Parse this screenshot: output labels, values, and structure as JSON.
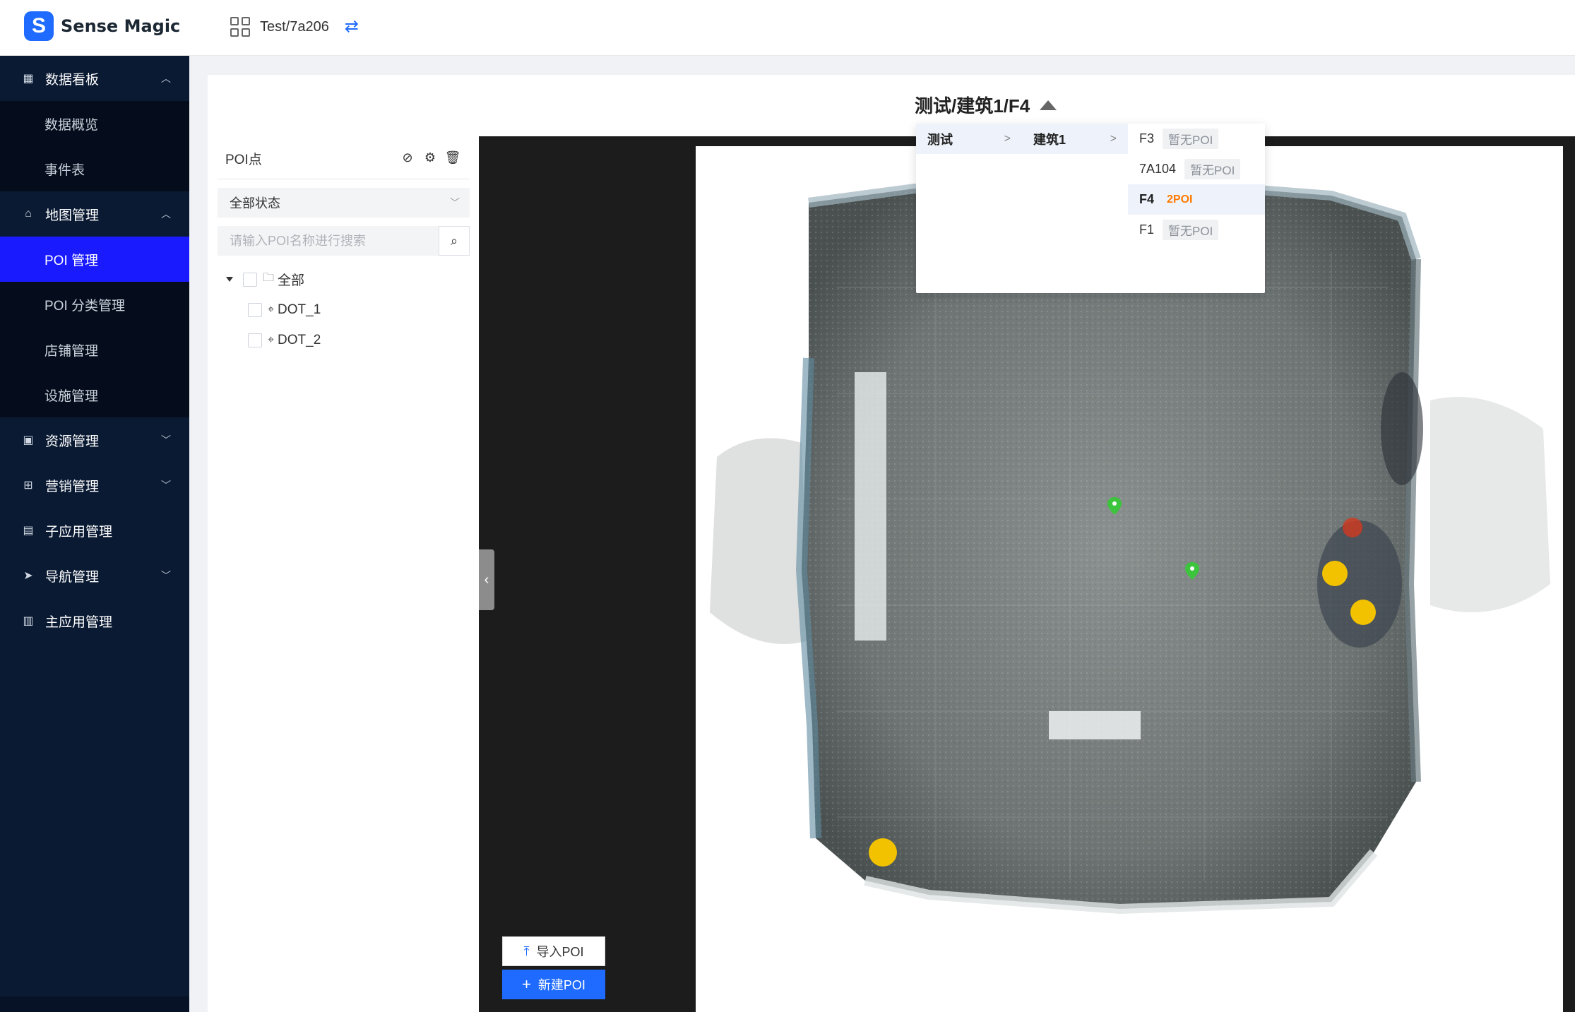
{
  "header": {
    "logo_letter": "S",
    "logo_text": "Sense Magic",
    "project_name": "Test/7a206"
  },
  "sidebar": {
    "groups": [
      {
        "label": "数据看板",
        "icon": "dashboard-icon",
        "expanded": true,
        "items": [
          "数据概览",
          "事件表"
        ]
      },
      {
        "label": "地图管理",
        "icon": "map-icon",
        "expanded": true,
        "items": [
          "POI 管理",
          "POI 分类管理",
          "店铺管理",
          "设施管理"
        ],
        "active_item": "POI 管理"
      },
      {
        "label": "资源管理",
        "icon": "resource-icon",
        "expanded": false
      },
      {
        "label": "营销管理",
        "icon": "marketing-icon",
        "expanded": false
      },
      {
        "label": "子应用管理",
        "icon": "subapp-icon",
        "expanded": false,
        "has_children": false
      },
      {
        "label": "导航管理",
        "icon": "navigation-icon",
        "expanded": false
      },
      {
        "label": "主应用管理",
        "icon": "mainapp-icon",
        "expanded": false,
        "has_children": false
      }
    ]
  },
  "floor_selector": {
    "title": "测试/建筑1/F4",
    "col1": [
      {
        "label": "测试",
        "selected": true
      }
    ],
    "col2": [
      {
        "label": "建筑1",
        "selected": true
      }
    ],
    "col3": [
      {
        "label": "F3",
        "tag": "暂无POI"
      },
      {
        "label": "7A104",
        "tag": "暂无POI"
      },
      {
        "label": "F4",
        "tag": "2POI",
        "selected": true
      },
      {
        "label": "F1",
        "tag": "暂无POI"
      }
    ]
  },
  "poi_panel": {
    "title": "POI点",
    "status_filter": "全部状态",
    "search_placeholder": "请输入POI名称进行搜索",
    "tree": {
      "root": "全部",
      "children": [
        "DOT_1",
        "DOT_2"
      ]
    }
  },
  "buttons": {
    "import_label": "导入POI",
    "new_label": "新建POI"
  },
  "colors": {
    "accent": "#1f6bff",
    "sidebar_bg": "#0a1a33",
    "active_item": "#1a1aff",
    "poi_marker": "#3cc43c",
    "tag_orange": "#ff7a00"
  }
}
